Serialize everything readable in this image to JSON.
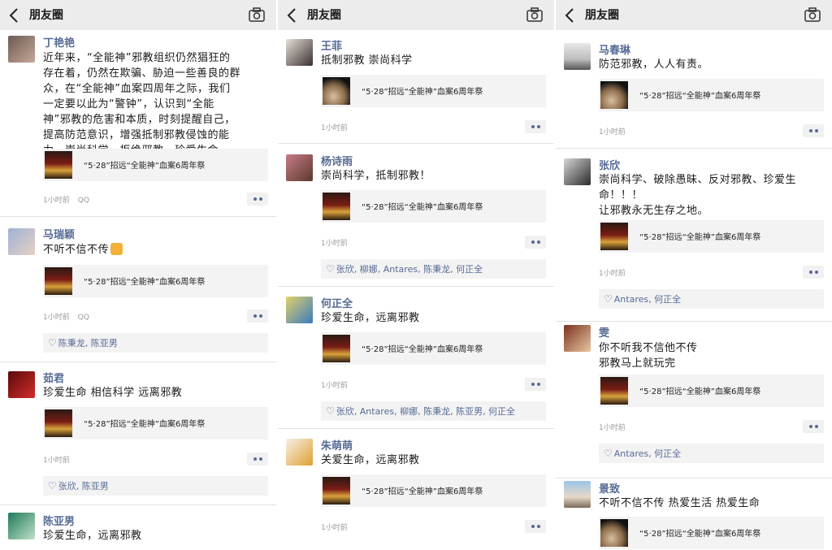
{
  "app": {
    "title": "朋友圈"
  },
  "columns": [
    {
      "posts": [
        {
          "name": "丁艳艳",
          "text": "近年来，“全能神”邪教组织仍然猖狂的\n存在着，仍然在欺骗、胁迫一些善良的群\n众，在“全能神”血案四周年之际，我们\n一定要以此为“警钟”，认识到“全能\n神”邪教的危害和本质，时刻提醒自己，\n提高防范意识，增强抵制邪教侵蚀的能\n力，崇尚科学、拒绝邪教、珍爱生命。",
          "share": "“5·28”招远“全能神”血案6周年祭",
          "time": "1小时前",
          "source": "QQ",
          "likes": ""
        },
        {
          "name": "马瑞颖",
          "text": "不听不信不传",
          "share": "“5·28”招远“全能神”血案6周年祭",
          "time": "1小时前",
          "source": "QQ",
          "likes": "陈秉龙, 陈亚男"
        },
        {
          "name": "茹君",
          "text": "珍爱生命 相信科学 远离邪教",
          "share": "“5·28”招远“全能神”血案6周年祭",
          "time": "1小时前",
          "source": "",
          "likes": "张欣, 陈亚男"
        },
        {
          "name": "陈亚男",
          "text": "珍爱生命，远离邪教",
          "share": "",
          "time": "",
          "source": "",
          "likes": ""
        }
      ]
    },
    {
      "posts": [
        {
          "name": "王菲",
          "text": "抵制邪教 崇尚科学",
          "share": "“5·28”招远“全能神”血案6周年祭",
          "time": "1小时前",
          "source": "",
          "likes": ""
        },
        {
          "name": "杨诗雨",
          "text": "崇尚科学，抵制邪教！",
          "share": "“5·28”招远“全能神”血案6周年祭",
          "time": "1小时前",
          "source": "",
          "likes": "张欣, 柳娜, Antares, 陈秉龙, 何正全"
        },
        {
          "name": "何正全",
          "text": "珍爱生命，远离邪教",
          "share": "“5·28”招远“全能神”血案6周年祭",
          "time": "1小时前",
          "source": "",
          "likes": "张欣, Antares, 柳娜, 陈秉龙, 陈亚男, 何正全"
        },
        {
          "name": "朱萌萌",
          "text": "关爱生命，远离邪教",
          "share": "“5·28”招远“全能神”血案6周年祭",
          "time": "1小时前",
          "source": "",
          "likes": ""
        }
      ]
    },
    {
      "posts": [
        {
          "name": "马春琳",
          "text": "防范邪教，人人有责。",
          "share": "“5·28”招远“全能神”血案6周年祭",
          "time": "1小时前",
          "source": "",
          "likes": ""
        },
        {
          "name": "张欣",
          "text": "崇尚科学、破除愚昧、反对邪教、珍爱生\n命！！！\n让邪教永无生存之地。",
          "share": "“5·28”招远“全能神”血案6周年祭",
          "time": "1小时前",
          "source": "",
          "likes": "Antares, 何正全"
        },
        {
          "name": "雯",
          "text": "你不听我不信他不传\n邪教马上就玩完",
          "share": "“5·28”招远“全能神”血案6周年祭",
          "time": "1小时前",
          "source": "",
          "likes": "Antares, 何正全"
        },
        {
          "name": "景致",
          "text": "不听不信不传 热爱生活 热爱生命",
          "share": "“5·28”招远“全能神”血案6周年祭",
          "time": "",
          "source": "",
          "likes": ""
        }
      ]
    }
  ]
}
